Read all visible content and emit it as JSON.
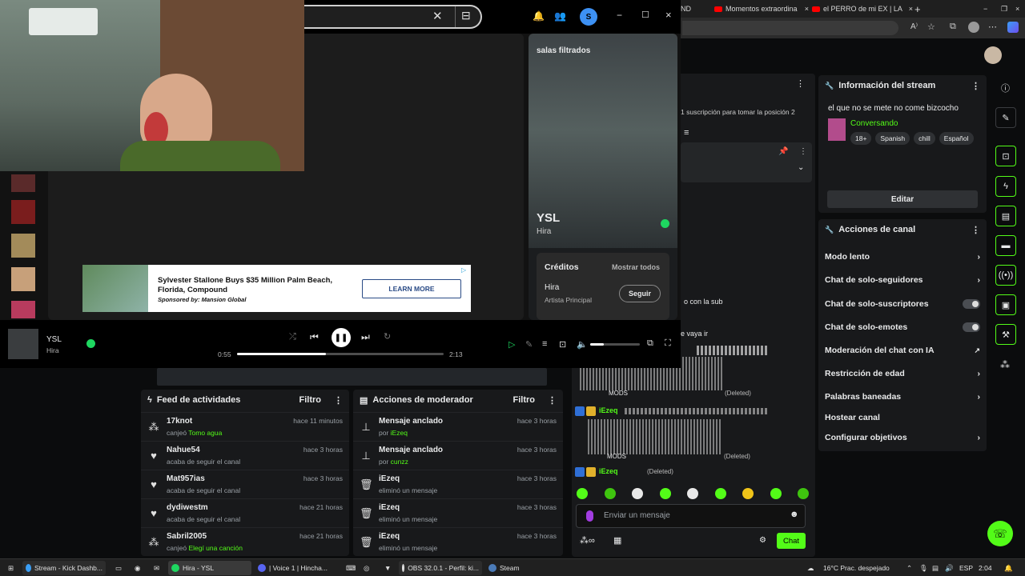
{
  "browser": {
    "tabs": [
      {
        "label": "ND"
      },
      {
        "label": "Momentos extraordina"
      },
      {
        "label": "el PERRO de mi EX | LA"
      }
    ]
  },
  "stream_info": {
    "header": "Información del stream",
    "title": "el que no se mete no come bizcocho",
    "category": "Conversando",
    "tags": [
      "18+",
      "Spanish",
      "chill",
      "Español"
    ],
    "edit_label": "Editar"
  },
  "channel_actions": {
    "header": "Acciones de canal",
    "items": [
      {
        "label": "Modo lento",
        "control": "chevron"
      },
      {
        "label": "Chat de solo-seguidores",
        "control": "chevron"
      },
      {
        "label": "Chat de solo-suscriptores",
        "control": "toggle"
      },
      {
        "label": "Chat de solo-emotes",
        "control": "toggle"
      },
      {
        "label": "Moderación del chat con IA",
        "control": "external"
      },
      {
        "label": "Restricción de edad",
        "control": "chevron"
      },
      {
        "label": "Palabras baneadas",
        "control": "chevron"
      },
      {
        "label": "Hostear canal",
        "control": "none"
      },
      {
        "label": "Configurar objetivos",
        "control": "chevron"
      }
    ]
  },
  "activity_feed": {
    "header": "Feed de actividades",
    "filter_label": "Filtro",
    "rows": [
      {
        "user": "17knot",
        "action": "canjeó",
        "highlight": "Tomo agua",
        "time": "hace 11 minutos",
        "icon": "points-icon"
      },
      {
        "user": "Nahue54",
        "action": "acaba de seguir el canal",
        "highlight": "",
        "time": "hace 3 horas",
        "icon": "heart-icon"
      },
      {
        "user": "Mat957ias",
        "action": "acaba de seguir el canal",
        "highlight": "",
        "time": "hace 3 horas",
        "icon": "heart-icon"
      },
      {
        "user": "dydiwestm",
        "action": "acaba de seguir el canal",
        "highlight": "",
        "time": "hace 21 horas",
        "icon": "heart-icon"
      },
      {
        "user": "Sabril2005",
        "action": "canjeó",
        "highlight": "Elegí una canción",
        "time": "hace 21 horas",
        "icon": "points-icon"
      }
    ]
  },
  "mod_actions": {
    "header": "Acciones de moderador",
    "filter_label": "Filtro",
    "rows": [
      {
        "title": "Mensaje anclado",
        "sub": "por",
        "user": "iEzeq",
        "time": "hace 3 horas",
        "icon": "pin-icon"
      },
      {
        "title": "Mensaje anclado",
        "sub": "por",
        "user": "cunzz",
        "time": "hace 3 horas",
        "icon": "pin-icon"
      },
      {
        "title": "iEzeq",
        "sub": "eliminó un mensaje",
        "user": "",
        "time": "hace 3 horas",
        "icon": "trash-icon"
      },
      {
        "title": "iEzeq",
        "sub": "eliminó un mensaje",
        "user": "",
        "time": "hace 3 horas",
        "icon": "trash-icon"
      },
      {
        "title": "iEzeq",
        "sub": "eliminó un mensaje",
        "user": "",
        "time": "hace 3 horas",
        "icon": "trash-icon"
      }
    ]
  },
  "chat": {
    "sub_notice": "1 suscripción para tomar la posición 2",
    "fragment_1": "o con la sub",
    "fragment_2": "e vaya ir",
    "mods_label": "MODS",
    "deleted_label": "(Deleted)",
    "user": "iEzeq",
    "input_placeholder": "Enviar un mensaje",
    "send_label": "Chat"
  },
  "spotify": {
    "panel_title": "salas filtrados",
    "track": "YSL",
    "artist": "Hira",
    "credits_title": "Créditos",
    "credits_show_all": "Mostrar todos",
    "credit_name": "Hira",
    "credit_role": "Artista Principal",
    "follow_label": "Seguir",
    "elapsed": "0:55",
    "duration": "2:13",
    "progress": 0.43,
    "volume": 0.28,
    "avatar_letter": "S",
    "ad": {
      "headline": "Sylvester Stallone Buys $35 Million Palm Beach, Florida, Compound",
      "sponsor": "Sponsored by: Mansion Global",
      "cta": "LEARN MORE"
    }
  },
  "taskbar": {
    "items": [
      "Stream - Kick Dashb...",
      "Hira - YSL",
      "| Voice 1 | Hincha...",
      "OBS 32.0.1 - Perfil: ki...",
      "Steam"
    ],
    "weather": "16°C  Prac. despejado",
    "lang": "ESP",
    "time": "2:04"
  }
}
